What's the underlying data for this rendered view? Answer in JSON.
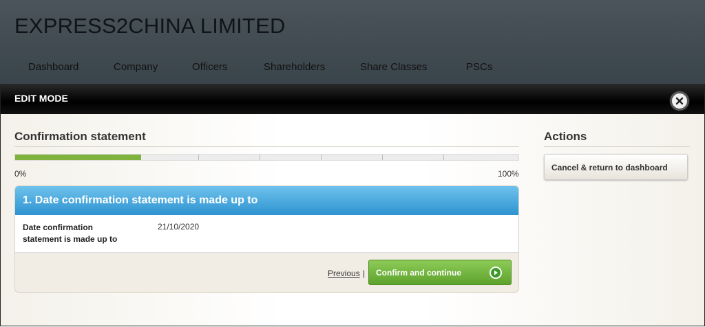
{
  "header": {
    "company_name": "EXPRESS2CHINA LIMITED",
    "nav": [
      "Dashboard",
      "Company",
      "Officers",
      "Shareholders",
      "Share Classes",
      "PSCs"
    ]
  },
  "modal": {
    "title": "EDIT MODE",
    "main": {
      "section_title": "Confirmation statement",
      "progress": {
        "value_fraction": 0.25,
        "min_label": "0%",
        "max_label": "100%",
        "color": "#7fb33d"
      },
      "step": {
        "heading": "1. Date confirmation statement is made up to",
        "field_label": "Date confirmation statement is made up to",
        "field_value": "21/10/2020"
      },
      "previous_label": "Previous",
      "separator": "|",
      "confirm_label": "Confirm and continue",
      "confirm_icon": "play-circle-icon"
    },
    "actions": {
      "title": "Actions",
      "cancel_label": "Cancel & return to dashboard"
    }
  },
  "colors": {
    "header_bg": "#434d54",
    "step_header": "#3a9ad6",
    "confirm_green": "#6fb23b"
  }
}
